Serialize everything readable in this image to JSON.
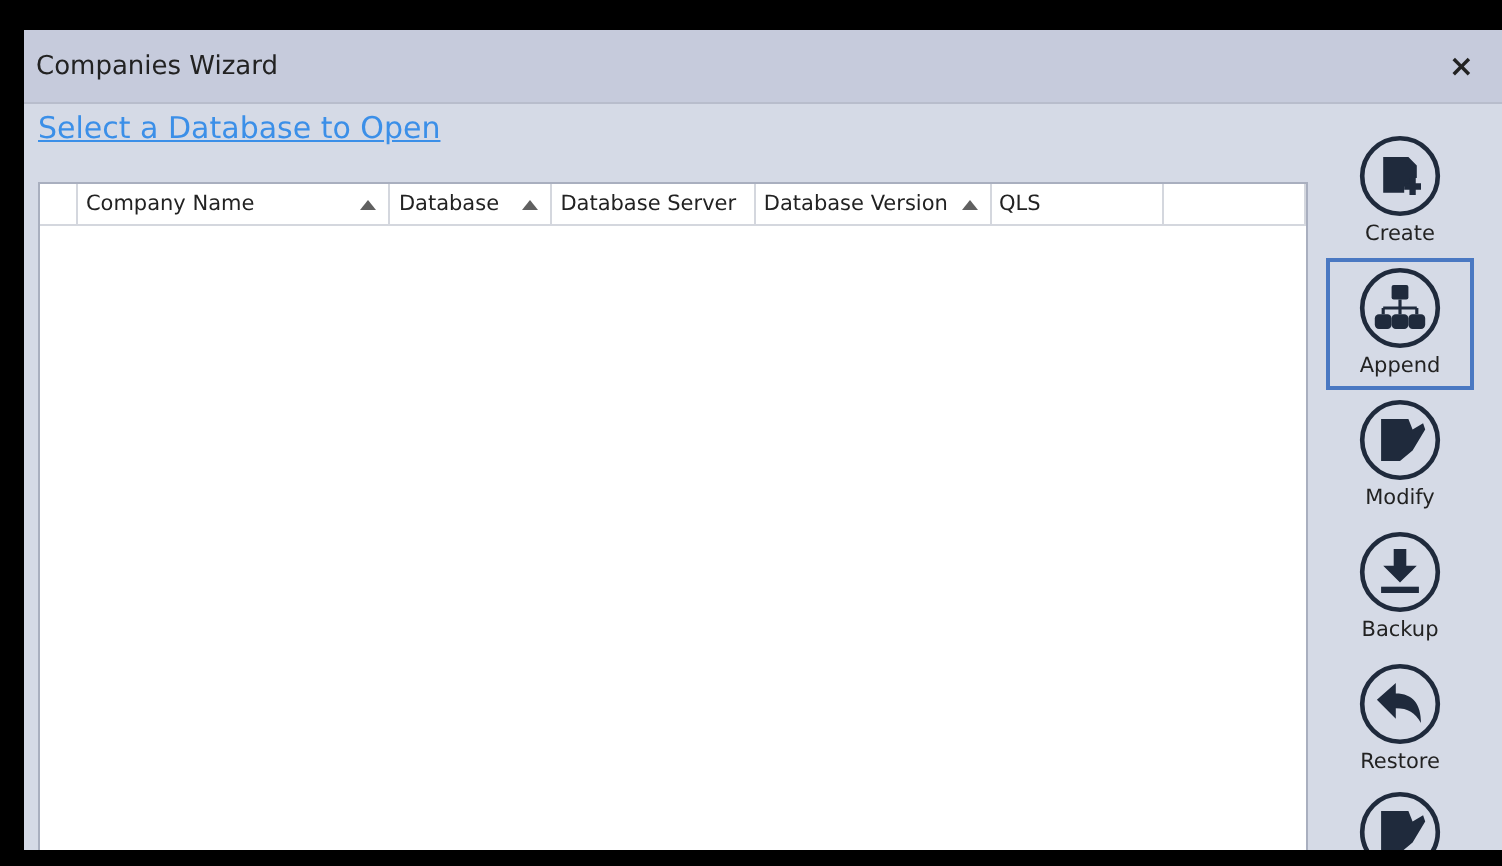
{
  "window": {
    "title": "Companies Wizard",
    "close": "×"
  },
  "heading_link": "Select a Database to Open",
  "table": {
    "columns": [
      {
        "label": "Company Name",
        "sort_arrow": true
      },
      {
        "label": "Database",
        "sort_arrow": true
      },
      {
        "label": "Database Server",
        "sort_arrow": false
      },
      {
        "label": "Database Version",
        "sort_arrow": true
      },
      {
        "label": "QLS",
        "sort_arrow": false
      }
    ]
  },
  "side_buttons": [
    {
      "kind": "create",
      "label": "Create",
      "selected": false
    },
    {
      "kind": "append",
      "label": "Append",
      "selected": true
    },
    {
      "kind": "modify",
      "label": "Modify",
      "selected": false
    },
    {
      "kind": "backup",
      "label": "Backup",
      "selected": false
    },
    {
      "kind": "restore",
      "label": "Restore",
      "selected": false
    }
  ]
}
